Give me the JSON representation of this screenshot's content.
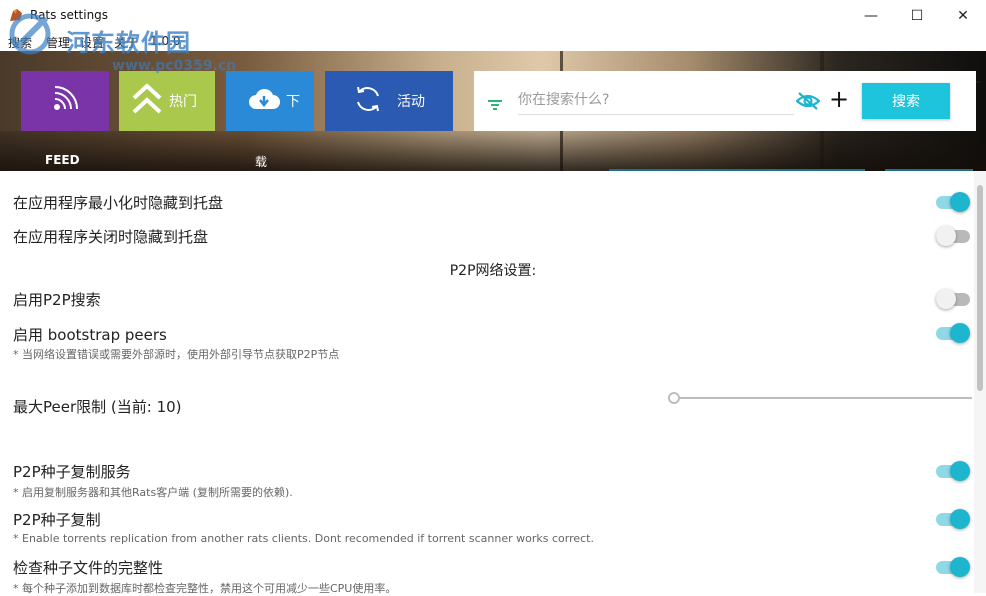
{
  "window": {
    "title": "Rats settings",
    "min_glyph": "—",
    "max_glyph": "☐",
    "close_glyph": "✕"
  },
  "menu": {
    "items": [
      "搜索",
      "管理",
      "设置",
      "关于"
    ],
    "version": "1.0.0"
  },
  "watermark": {
    "text": "河东软件园",
    "url": "www.pc0359.cn"
  },
  "tiles": {
    "feed": {
      "label": "FEED",
      "icon": "rss-icon"
    },
    "hot": {
      "label": "热门",
      "icon": "double-chevron-up-icon"
    },
    "download": {
      "label": "下",
      "sub": "载",
      "icon": "cloud-download-icon"
    },
    "activity": {
      "label": "活动",
      "icon": "refresh-icon"
    }
  },
  "search": {
    "placeholder": "你在搜索什么?",
    "button_label": "搜索",
    "plus_label": "+"
  },
  "settings": {
    "rows": [
      {
        "label": "在应用程序最小化时隐藏到托盘",
        "enabled": true
      },
      {
        "label": "在应用程序关闭时隐藏到托盘",
        "enabled": false
      }
    ],
    "p2p_section_title": "P2P网络设置:",
    "p2p_search": {
      "label": "启用P2P搜索",
      "enabled": false
    },
    "bootstrap": {
      "label": "启用 bootstrap peers",
      "note": "* 当网络设置错误或需要外部源时，使用外部引导节点获取P2P节点",
      "enabled": true
    },
    "max_peer": {
      "label": "最大Peer限制 (当前: 10)",
      "value": 10
    },
    "replication_server": {
      "label": "P2P种子复制服务",
      "note": "* 启用复制服务器和其他Rats客户端 (复制所需要的依赖).",
      "enabled": true
    },
    "replication": {
      "label": "P2P种子复制",
      "note": "* Enable torrents replication from another rats clients. Dont recomended if torrent scanner works correct.",
      "enabled": true
    },
    "integrity": {
      "label": "检查种子文件的完整性",
      "note": "* 每个种子添加到数据库时都检查完整性，禁用这个可用减少一些CPU使用率。",
      "enabled": true
    }
  },
  "colors": {
    "accent": "#1eb5cf",
    "feed_tile": "#7a34a8",
    "hot_tile": "#a9c84c",
    "download_tile": "#2a8ad7",
    "activity_tile": "#2a5ab2",
    "search_button": "#1ec3dc"
  }
}
